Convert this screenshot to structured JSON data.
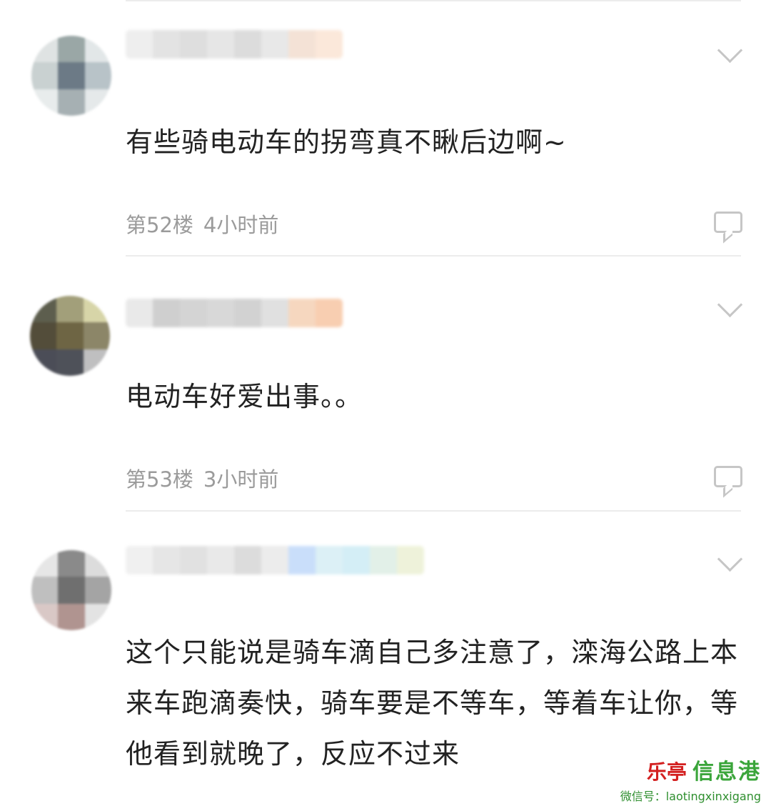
{
  "comments": [
    {
      "text": "有些骑电动车的拐弯真不瞅后边啊~",
      "floor": "第52楼",
      "time": "4小时前",
      "avatar_colors": [
        "#dfe3e3",
        "#9aa7a6",
        "#e2e7e8",
        "#c9d1d1",
        "#6c7a86",
        "#b8c3c8",
        "#e8ecec",
        "#a6b0b3",
        "#e5e9ea"
      ],
      "name_colors": [
        "#eeeeee",
        "#e3e3e3",
        "#dedede",
        "#e6e6e6",
        "#dcdcdc",
        "#e8e8e8",
        "#f4e2d6",
        "#fbe8da"
      ]
    },
    {
      "text": "电动车好爱出事。。",
      "floor": "第53楼",
      "time": "3小时前",
      "avatar_colors": [
        "#5d5e4e",
        "#a29f7a",
        "#d7d5a8",
        "#534d3a",
        "#6e6544",
        "#8c8668",
        "#4b4d57",
        "#4e5159",
        "#bfbfc0"
      ],
      "name_colors": [
        "#e9e9e9",
        "#cfcfcf",
        "#d4d4d4",
        "#d8d8d8",
        "#d2d2d2",
        "#e0e0e0",
        "#f6d7bf",
        "#f8ceb1"
      ]
    },
    {
      "text": "这个只能说是骑车滴自己多注意了，滦海公路上本来车跑滴奏快，骑车要是不等车，等着车让你，等他看到就晚了，反应不过来",
      "floor": "",
      "time": "",
      "avatar_colors": [
        "#e6e6e6",
        "#8a8a8a",
        "#dcdcdc",
        "#bfbfbf",
        "#6f6f6f",
        "#a4a4a4",
        "#d9c8c6",
        "#b09490",
        "#e3e3e3"
      ],
      "name_colors": [
        "#f0f0f0",
        "#e6e6e6",
        "#e1e1e1",
        "#e9e9e9",
        "#dcdcdc",
        "#ececec",
        "#c9defa",
        "#dcf0f6",
        "#d4eef6",
        "#e2f0e8",
        "#eef2da"
      ]
    }
  ],
  "watermark": {
    "logo": "乐亭",
    "main": "信息港",
    "sub": "微信号：laotingxinxigang"
  }
}
